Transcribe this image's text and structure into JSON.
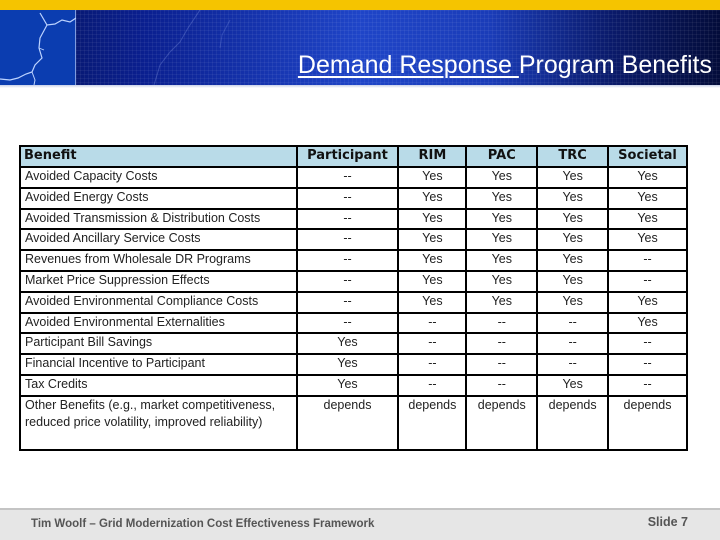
{
  "header": {
    "title_underlined": "Demand Response ",
    "title_rest": "Program Benefits",
    "colors": {
      "accent_strip": "#f5c400",
      "banner": "#1a3cb8",
      "table_header": "#b9dbe8"
    }
  },
  "table": {
    "columns": [
      "Benefit",
      "Participant",
      "RIM",
      "PAC",
      "TRC",
      "Societal"
    ],
    "rows": [
      {
        "benefit": "Avoided Capacity Costs",
        "participant": "--",
        "rim": "Yes",
        "pac": "Yes",
        "trc": "Yes",
        "societal": "Yes"
      },
      {
        "benefit": "Avoided Energy Costs",
        "participant": "--",
        "rim": "Yes",
        "pac": "Yes",
        "trc": "Yes",
        "societal": "Yes"
      },
      {
        "benefit": "Avoided Transmission & Distribution Costs",
        "participant": "--",
        "rim": "Yes",
        "pac": "Yes",
        "trc": "Yes",
        "societal": "Yes"
      },
      {
        "benefit": "Avoided Ancillary Service Costs",
        "participant": "--",
        "rim": "Yes",
        "pac": "Yes",
        "trc": "Yes",
        "societal": "Yes"
      },
      {
        "benefit": "Revenues from Wholesale DR Programs",
        "participant": "--",
        "rim": "Yes",
        "pac": "Yes",
        "trc": "Yes",
        "societal": "--"
      },
      {
        "benefit": "Market Price Suppression Effects",
        "participant": "--",
        "rim": "Yes",
        "pac": "Yes",
        "trc": "Yes",
        "societal": "--"
      },
      {
        "benefit": "Avoided Environmental Compliance Costs",
        "participant": "--",
        "rim": "Yes",
        "pac": "Yes",
        "trc": "Yes",
        "societal": "Yes"
      },
      {
        "benefit": "Avoided Environmental Externalities",
        "participant": "--",
        "rim": "--",
        "pac": "--",
        "trc": "--",
        "societal": "Yes"
      },
      {
        "benefit": "Participant Bill Savings",
        "participant": "Yes",
        "rim": "--",
        "pac": "--",
        "trc": "--",
        "societal": "--"
      },
      {
        "benefit": "Financial Incentive to Participant",
        "participant": "Yes",
        "rim": "--",
        "pac": "--",
        "trc": "--",
        "societal": "--"
      },
      {
        "benefit": "Tax Credits",
        "participant": "Yes",
        "rim": "--",
        "pac": "--",
        "trc": "Yes",
        "societal": "--"
      },
      {
        "benefit": "Other Benefits (e.g., market competitiveness, reduced price volatility, improved reliability)",
        "participant": "depends",
        "rim": "depends",
        "pac": "depends",
        "trc": "depends",
        "societal": "depends"
      }
    ]
  },
  "footer": {
    "left": "Tim Woolf – Grid Modernization Cost Effectiveness Framework",
    "right": "Slide 7"
  }
}
